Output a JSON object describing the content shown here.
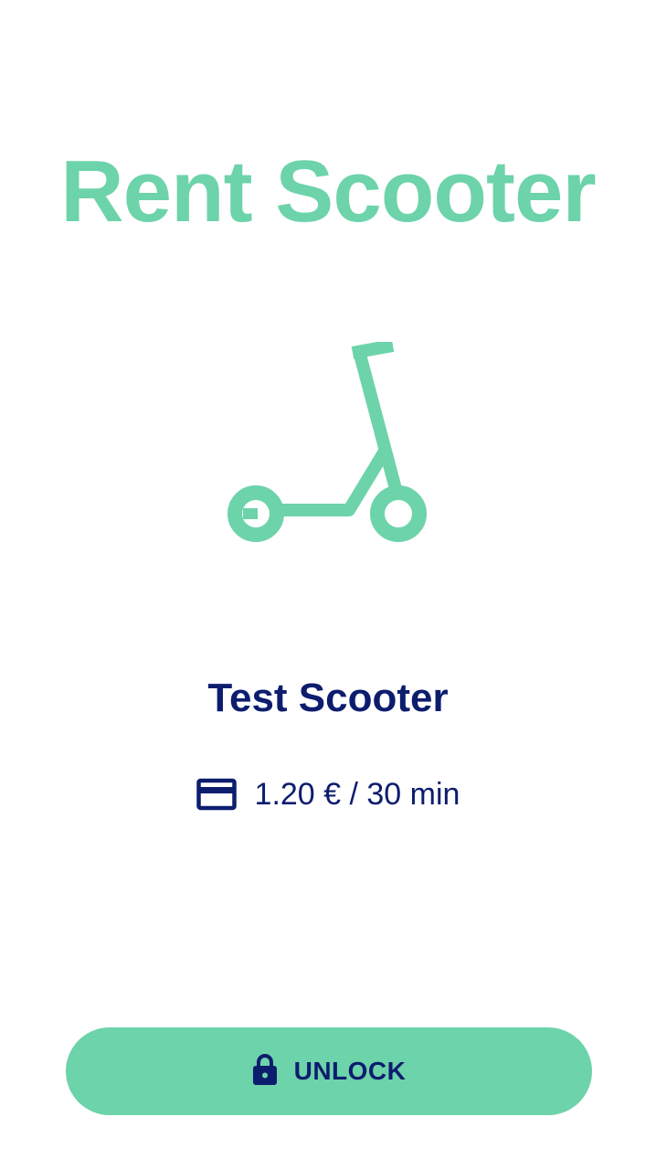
{
  "screen": {
    "title": "Rent Scooter"
  },
  "scooter": {
    "icon": "scooter-icon",
    "name": "Test Scooter",
    "price_icon": "credit-card-icon",
    "price": "1.20 € / 30 min"
  },
  "actions": {
    "unlock_icon": "lock-icon",
    "unlock_label": "UNLOCK"
  },
  "colors": {
    "accent": "#6dd3aa",
    "text_primary": "#0d1d6e",
    "background": "#ffffff"
  }
}
